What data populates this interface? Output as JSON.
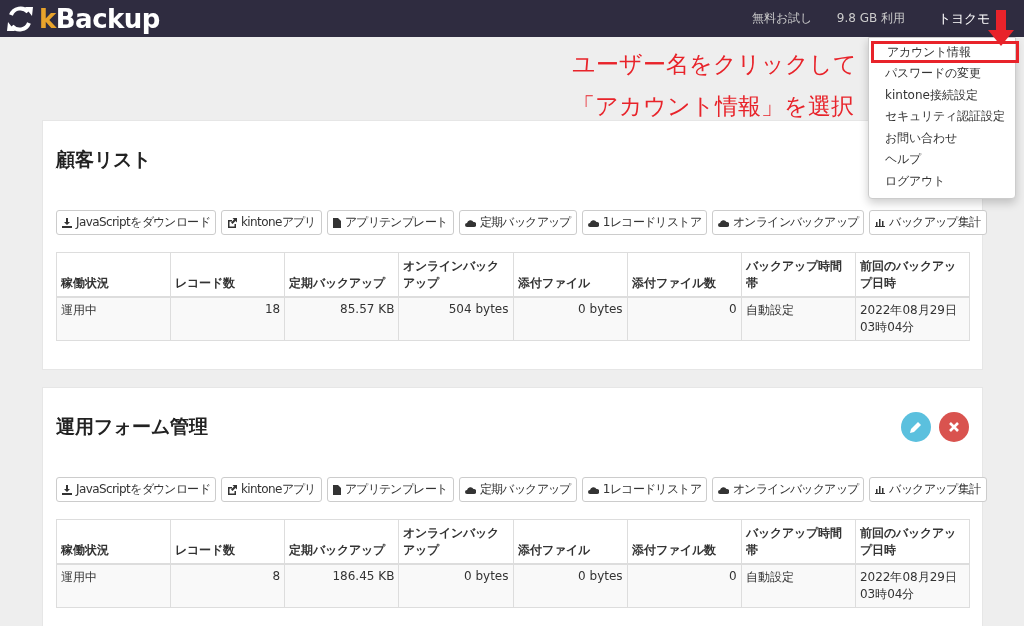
{
  "header": {
    "logo_accent": "k",
    "logo_rest": "Backup",
    "links": [
      "無料お試し",
      "9.8 GB 利用"
    ],
    "user": "トヨクモ"
  },
  "user_menu": {
    "items": [
      {
        "label": "アカウント情報",
        "highlighted": true
      },
      {
        "label": "パスワードの変更",
        "highlighted": false
      },
      {
        "label": "kintone接続設定",
        "highlighted": false
      },
      {
        "label": "セキュリティ認証設定",
        "highlighted": false
      },
      {
        "label": "お問い合わせ",
        "highlighted": false
      },
      {
        "label": "ヘルプ",
        "highlighted": false
      },
      {
        "label": "ログアウト",
        "highlighted": false
      }
    ]
  },
  "annotation": {
    "lines": [
      "ユーザー名をクリックして",
      "「アカウント情報」を選択"
    ]
  },
  "apps": [
    {
      "title": "顧客リスト",
      "buttons": [
        "JavaScriptをダウンロード",
        "kintoneアプリ",
        "アプリテンプレート",
        "定期バックアップ",
        "1レコードリストア",
        "オンラインバックアップ",
        "バックアップ集計"
      ],
      "columns": [
        "稼働状況",
        "レコード数",
        "定期バックアップ",
        "オンラインバックアップ",
        "添付ファイル",
        "添付ファイル数",
        "バックアップ時間帯",
        "前回のバックアップ日時"
      ],
      "rows": [
        [
          "運用中",
          "18",
          "85.57 KB",
          "504 bytes",
          "0 bytes",
          "0",
          "自動設定",
          "2022年08月29日 03時04分"
        ]
      ]
    },
    {
      "title": "運用フォーム管理",
      "actions": [
        {
          "kind": "edit"
        },
        {
          "kind": "delete"
        }
      ],
      "buttons": [
        "JavaScriptをダウンロード",
        "kintoneアプリ",
        "アプリテンプレート",
        "定期バックアップ",
        "1レコードリストア",
        "オンラインバックアップ",
        "バックアップ集計"
      ],
      "columns": [
        "稼働状況",
        "レコード数",
        "定期バックアップ",
        "オンラインバックアップ",
        "添付ファイル",
        "添付ファイル数",
        "バックアップ時間帯",
        "前回のバックアップ日時"
      ],
      "rows": [
        [
          "運用中",
          "8",
          "186.45 KB",
          "0 bytes",
          "0 bytes",
          "0",
          "自動設定",
          "2022年08月29日 03時04分"
        ]
      ]
    }
  ]
}
